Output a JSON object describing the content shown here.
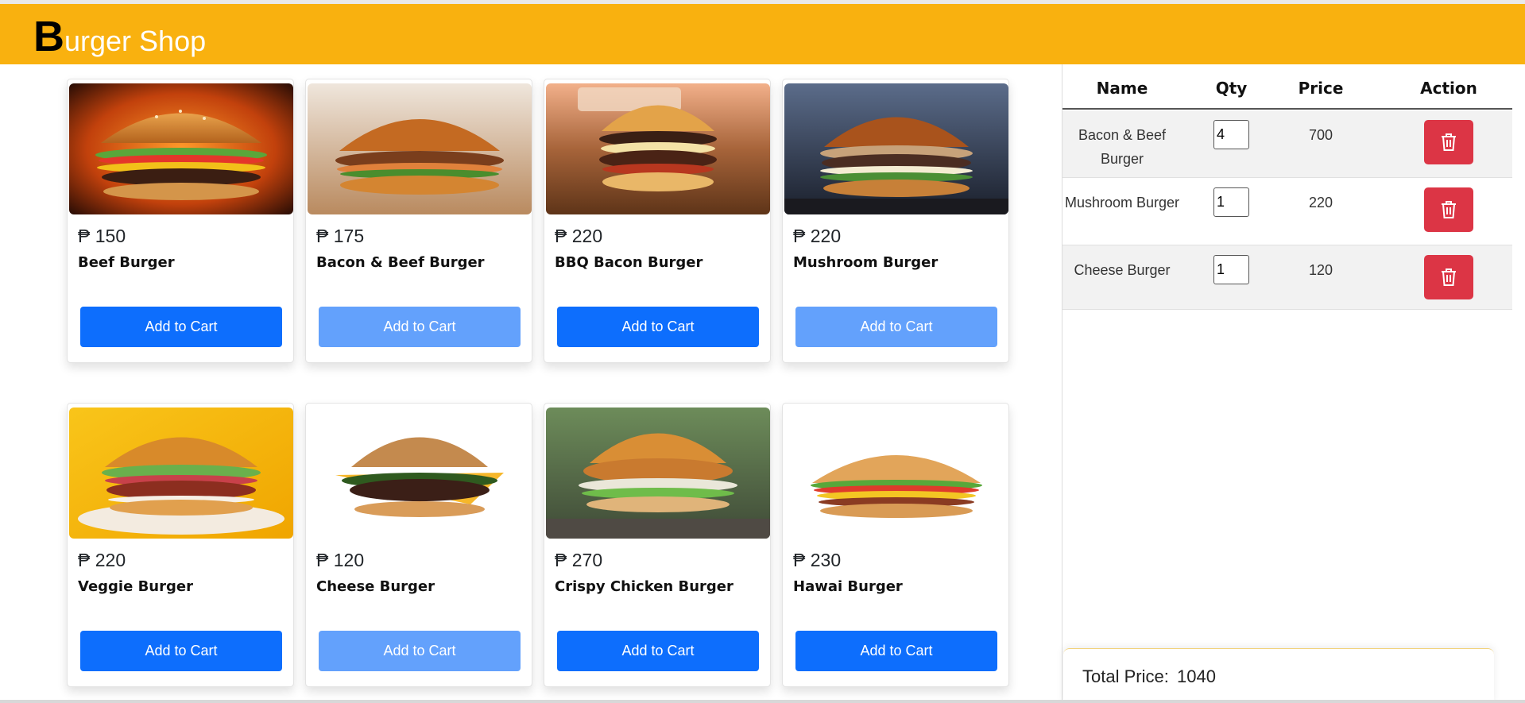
{
  "app": {
    "logo_first_letter": "B",
    "logo_rest": "urger Shop",
    "colors": {
      "header": "#f9b10f",
      "primary": "#0d6efd",
      "primary_disabled": "#63a1fc",
      "danger": "#dc3545"
    }
  },
  "products": [
    {
      "price": "₱ 150",
      "name": "Beef Burger",
      "button": "Add to Cart",
      "button_state": "enabled",
      "image": "beef-burger"
    },
    {
      "price": "₱ 175",
      "name": "Bacon & Beef Burger",
      "button": "Add to Cart",
      "button_state": "disabled",
      "image": "bacon-beef-burger"
    },
    {
      "price": "₱ 220",
      "name": "BBQ Bacon Burger",
      "button": "Add to Cart",
      "button_state": "enabled",
      "image": "bbq-bacon-burger"
    },
    {
      "price": "₱ 220",
      "name": "Mushroom Burger",
      "button": "Add to Cart",
      "button_state": "disabled",
      "image": "mushroom-burger"
    },
    {
      "price": "₱ 220",
      "name": "Veggie Burger",
      "button": "Add to Cart",
      "button_state": "enabled",
      "image": "veggie-burger"
    },
    {
      "price": "₱ 120",
      "name": "Cheese Burger",
      "button": "Add to Cart",
      "button_state": "disabled",
      "image": "cheese-burger"
    },
    {
      "price": "₱ 270",
      "name": "Crispy Chicken Burger",
      "button": "Add to Cart",
      "button_state": "enabled",
      "image": "crispy-chicken-burger"
    },
    {
      "price": "₱ 230",
      "name": "Hawai Burger",
      "button": "Add to Cart",
      "button_state": "enabled",
      "image": "hawai-burger"
    }
  ],
  "cart": {
    "headers": {
      "name": "Name",
      "qty": "Qty",
      "price": "Price",
      "action": "Action"
    },
    "items": [
      {
        "name": "Bacon & Beef Burger",
        "qty": "4",
        "price": "700",
        "action_icon": "trash-icon"
      },
      {
        "name": "Mushroom Burger",
        "qty": "1",
        "price": "220",
        "action_icon": "trash-icon"
      },
      {
        "name": "Cheese Burger",
        "qty": "1",
        "price": "120",
        "action_icon": "trash-icon"
      }
    ],
    "total_label": "Total Price:",
    "total_value": "1040"
  }
}
